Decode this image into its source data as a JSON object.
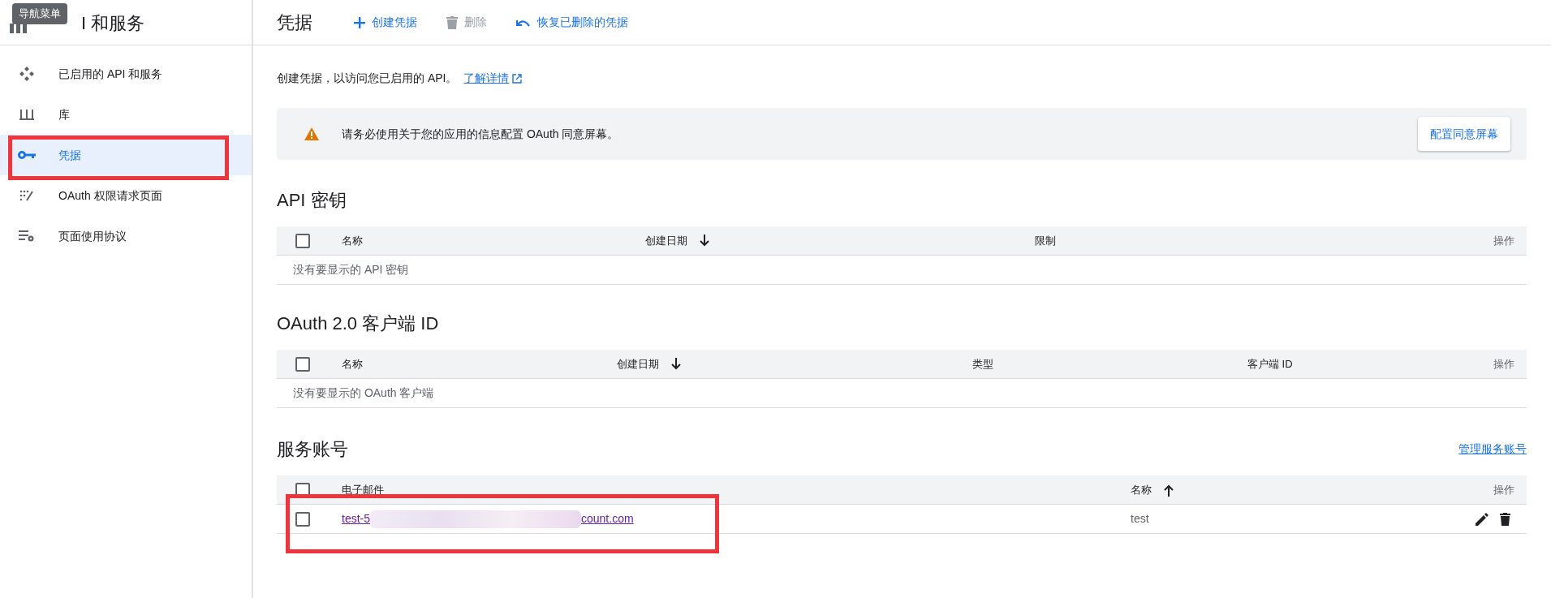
{
  "tooltip": "导航菜单",
  "sidebar": {
    "title": "I 和服务",
    "items": [
      {
        "label": "已启用的 API 和服务",
        "selected": false
      },
      {
        "label": "库",
        "selected": false
      },
      {
        "label": "凭据",
        "selected": true
      },
      {
        "label": "OAuth 权限请求页面",
        "selected": false
      },
      {
        "label": "页面使用协议",
        "selected": false
      }
    ]
  },
  "header": {
    "title": "凭据",
    "actions": [
      {
        "label": "创建凭据",
        "disabled": false
      },
      {
        "label": "删除",
        "disabled": true
      },
      {
        "label": "恢复已删除的凭据",
        "disabled": false
      }
    ]
  },
  "intro": {
    "text": "创建凭据，以访问您已启用的 API。",
    "link": "了解详情"
  },
  "banner": {
    "text": "请务必使用关于您的应用的信息配置 OAuth 同意屏幕。",
    "button": "配置同意屏幕"
  },
  "sections": [
    {
      "title": "API 密钥",
      "select_all_checked": false,
      "columns": [
        {
          "label": "名称",
          "kind": "plain"
        },
        {
          "label": "创建日期",
          "kind": "descending"
        },
        {
          "label": "限制",
          "kind": "plain"
        },
        {
          "label": "操作",
          "kind": "plain"
        }
      ],
      "empty": "没有要显示的 API 密钥"
    },
    {
      "title": "OAuth 2.0 客户端 ID",
      "select_all_checked": false,
      "columns": [
        {
          "label": "名称",
          "kind": "plain"
        },
        {
          "label": "创建日期",
          "kind": "descending"
        },
        {
          "label": "类型",
          "kind": "plain"
        },
        {
          "label": "客户端 ID",
          "kind": "plain"
        },
        {
          "label": "操作",
          "kind": "plain"
        }
      ],
      "empty": "没有要显示的 OAuth 客户端"
    },
    {
      "title": "服务账号",
      "select_all_checked": false,
      "link": "管理服务账号",
      "columns": [
        {
          "label": "电子邮件",
          "kind": "plain"
        },
        {
          "label": "名称",
          "kind": "ascending"
        },
        {
          "label": "操作",
          "kind": "plain"
        }
      ],
      "rows": [
        {
          "checked": false,
          "email_start": "test-5",
          "email_end": "count.com",
          "name": "test"
        }
      ]
    }
  ]
}
